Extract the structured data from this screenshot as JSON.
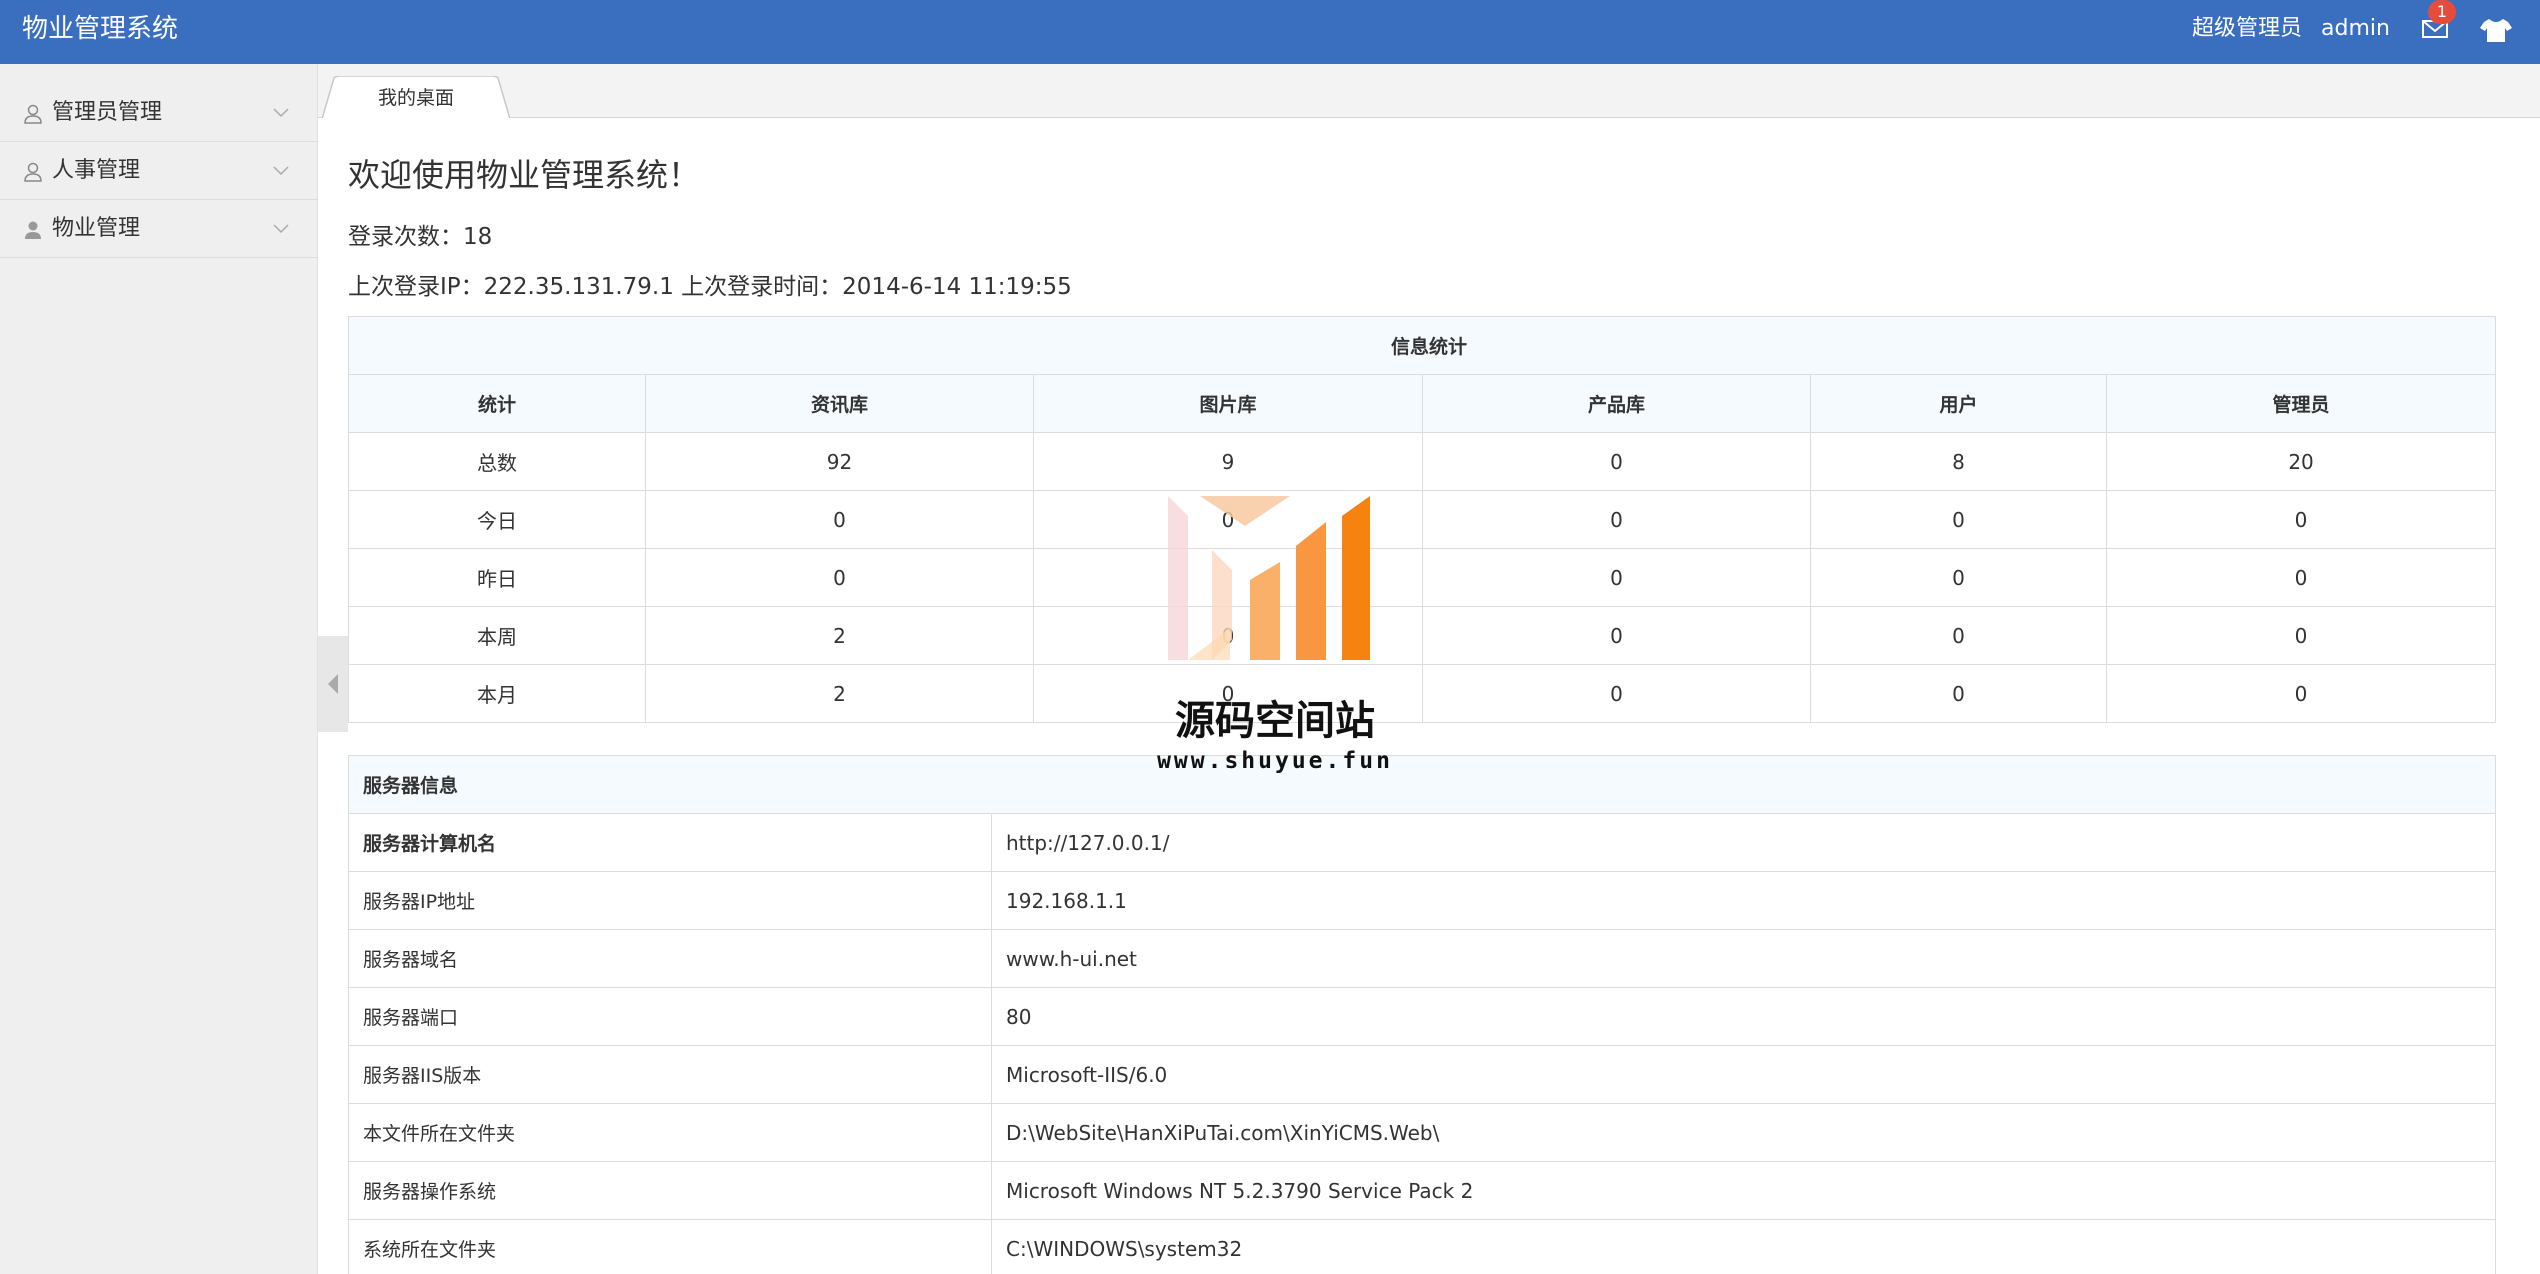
{
  "header": {
    "app_title": "物业管理系统",
    "user_role": "超级管理员",
    "user_name": "admin",
    "message_count": "1",
    "icons": [
      "mail-icon",
      "tshirt-skin-icon"
    ],
    "color": "#3a6ebf"
  },
  "sidebar": {
    "items": [
      {
        "label": "管理员管理",
        "icon": "user-outline-icon"
      },
      {
        "label": "人事管理",
        "icon": "user-outline-icon"
      },
      {
        "label": "物业管理",
        "icon": "user-filled-icon"
      }
    ]
  },
  "tabs": [
    {
      "label": "我的桌面"
    }
  ],
  "welcome": {
    "title": "欢迎使用物业管理系统！",
    "login_count": "登录次数：18",
    "last_login": "上次登录IP：222.35.131.79.1  上次登录时间：2014-6-14 11:19:55"
  },
  "stats": {
    "caption": "信息统计",
    "headers": [
      "统计",
      "资讯库",
      "图片库",
      "产品库",
      "用户",
      "管理员"
    ],
    "rows": [
      [
        "总数",
        "92",
        "9",
        "0",
        "8",
        "20"
      ],
      [
        "今日",
        "0",
        "0",
        "0",
        "0",
        "0"
      ],
      [
        "昨日",
        "0",
        "",
        "0",
        "0",
        "0"
      ],
      [
        "本周",
        "2",
        "0",
        "0",
        "0",
        "0"
      ],
      [
        "本月",
        "2",
        "0",
        "0",
        "0",
        "0"
      ]
    ]
  },
  "server": {
    "caption": "服务器信息",
    "rows": [
      [
        "服务器计算机名",
        "http://127.0.0.1/"
      ],
      [
        "服务器IP地址",
        "192.168.1.1"
      ],
      [
        "服务器域名",
        "www.h-ui.net"
      ],
      [
        "服务器端口",
        "80"
      ],
      [
        "服务器IIS版本",
        "Microsoft-IIS/6.0"
      ],
      [
        "本文件所在文件夹",
        "D:\\WebSite\\HanXiPuTai.com\\XinYiCMS.Web\\"
      ],
      [
        "服务器操作系统",
        "Microsoft Windows NT 5.2.3790 Service Pack 2"
      ],
      [
        "系统所在文件夹",
        "C:\\WINDOWS\\system32"
      ]
    ]
  },
  "watermark": {
    "text": "源码空间站",
    "url": "www.shuyue.fun"
  }
}
